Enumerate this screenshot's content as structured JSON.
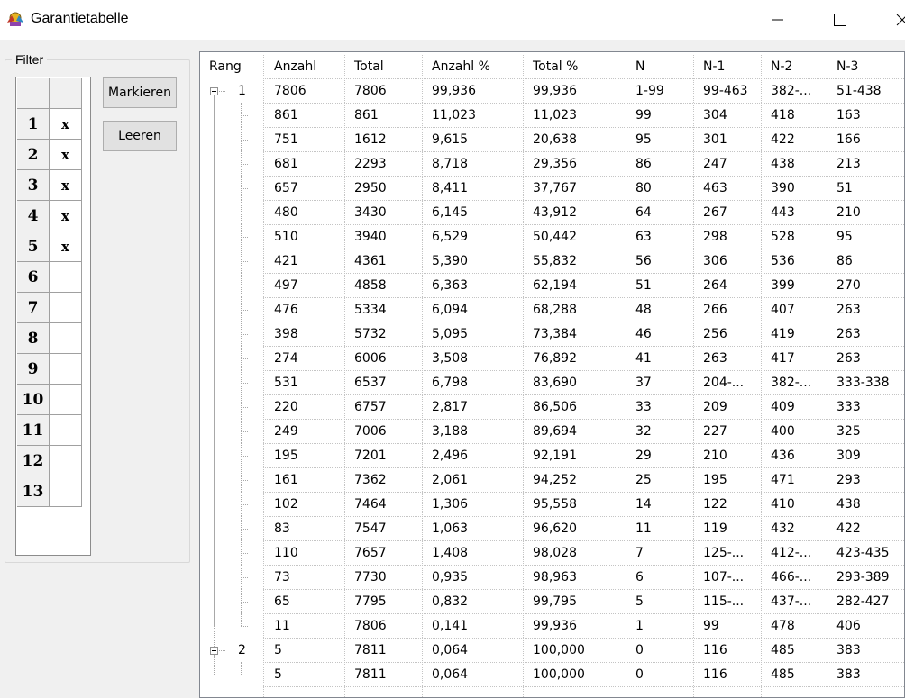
{
  "window": {
    "title": "Garantietabelle",
    "icon": "app-icon"
  },
  "filter": {
    "legend": "Filter",
    "rows": [
      {
        "num": "1",
        "val": "x"
      },
      {
        "num": "2",
        "val": "x"
      },
      {
        "num": "3",
        "val": "x"
      },
      {
        "num": "4",
        "val": "x"
      },
      {
        "num": "5",
        "val": "x"
      },
      {
        "num": "6",
        "val": ""
      },
      {
        "num": "7",
        "val": ""
      },
      {
        "num": "8",
        "val": ""
      },
      {
        "num": "9",
        "val": ""
      },
      {
        "num": "10",
        "val": ""
      },
      {
        "num": "11",
        "val": ""
      },
      {
        "num": "12",
        "val": ""
      },
      {
        "num": "13",
        "val": ""
      }
    ],
    "mark_label": "Markieren",
    "clear_label": "Leeren"
  },
  "table": {
    "columns": [
      "Rang",
      "Anzahl",
      "Total",
      "Anzahl %",
      "Total %",
      "N",
      "N-1",
      "N-2",
      "N-3"
    ],
    "rows": [
      {
        "level": 0,
        "rang": "1",
        "cells": [
          "7806",
          "7806",
          "99,936",
          "99,936",
          "1-99",
          "99-463",
          "382-...",
          "51-438"
        ]
      },
      {
        "level": 1,
        "rang": "",
        "cells": [
          "861",
          "861",
          "11,023",
          "11,023",
          "99",
          "304",
          "418",
          "163"
        ]
      },
      {
        "level": 1,
        "rang": "",
        "cells": [
          "751",
          "1612",
          "9,615",
          "20,638",
          "95",
          "301",
          "422",
          "166"
        ]
      },
      {
        "level": 1,
        "rang": "",
        "cells": [
          "681",
          "2293",
          "8,718",
          "29,356",
          "86",
          "247",
          "438",
          "213"
        ]
      },
      {
        "level": 1,
        "rang": "",
        "cells": [
          "657",
          "2950",
          "8,411",
          "37,767",
          "80",
          "463",
          "390",
          "51"
        ]
      },
      {
        "level": 1,
        "rang": "",
        "cells": [
          "480",
          "3430",
          "6,145",
          "43,912",
          "64",
          "267",
          "443",
          "210"
        ]
      },
      {
        "level": 1,
        "rang": "",
        "cells": [
          "510",
          "3940",
          "6,529",
          "50,442",
          "63",
          "298",
          "528",
          "95"
        ]
      },
      {
        "level": 1,
        "rang": "",
        "cells": [
          "421",
          "4361",
          "5,390",
          "55,832",
          "56",
          "306",
          "536",
          "86"
        ]
      },
      {
        "level": 1,
        "rang": "",
        "cells": [
          "497",
          "4858",
          "6,363",
          "62,194",
          "51",
          "264",
          "399",
          "270"
        ]
      },
      {
        "level": 1,
        "rang": "",
        "cells": [
          "476",
          "5334",
          "6,094",
          "68,288",
          "48",
          "266",
          "407",
          "263"
        ]
      },
      {
        "level": 1,
        "rang": "",
        "cells": [
          "398",
          "5732",
          "5,095",
          "73,384",
          "46",
          "256",
          "419",
          "263"
        ]
      },
      {
        "level": 1,
        "rang": "",
        "cells": [
          "274",
          "6006",
          "3,508",
          "76,892",
          "41",
          "263",
          "417",
          "263"
        ]
      },
      {
        "level": 1,
        "rang": "",
        "cells": [
          "531",
          "6537",
          "6,798",
          "83,690",
          "37",
          "204-...",
          "382-...",
          "333-338"
        ]
      },
      {
        "level": 1,
        "rang": "",
        "cells": [
          "220",
          "6757",
          "2,817",
          "86,506",
          "33",
          "209",
          "409",
          "333"
        ]
      },
      {
        "level": 1,
        "rang": "",
        "cells": [
          "249",
          "7006",
          "3,188",
          "89,694",
          "32",
          "227",
          "400",
          "325"
        ]
      },
      {
        "level": 1,
        "rang": "",
        "cells": [
          "195",
          "7201",
          "2,496",
          "92,191",
          "29",
          "210",
          "436",
          "309"
        ]
      },
      {
        "level": 1,
        "rang": "",
        "cells": [
          "161",
          "7362",
          "2,061",
          "94,252",
          "25",
          "195",
          "471",
          "293"
        ]
      },
      {
        "level": 1,
        "rang": "",
        "cells": [
          "102",
          "7464",
          "1,306",
          "95,558",
          "14",
          "122",
          "410",
          "438"
        ]
      },
      {
        "level": 1,
        "rang": "",
        "cells": [
          "83",
          "7547",
          "1,063",
          "96,620",
          "11",
          "119",
          "432",
          "422"
        ]
      },
      {
        "level": 1,
        "rang": "",
        "cells": [
          "110",
          "7657",
          "1,408",
          "98,028",
          "7",
          "125-...",
          "412-...",
          "423-435"
        ]
      },
      {
        "level": 1,
        "rang": "",
        "cells": [
          "73",
          "7730",
          "0,935",
          "98,963",
          "6",
          "107-...",
          "466-...",
          "293-389"
        ]
      },
      {
        "level": 1,
        "rang": "",
        "cells": [
          "65",
          "7795",
          "0,832",
          "99,795",
          "5",
          "115-...",
          "437-...",
          "282-427"
        ]
      },
      {
        "level": 1,
        "rang": "",
        "cells": [
          "11",
          "7806",
          "0,141",
          "99,936",
          "1",
          "99",
          "478",
          "406"
        ]
      },
      {
        "level": 0,
        "rang": "2",
        "cells": [
          "5",
          "7811",
          "0,064",
          "100,000",
          "0",
          "116",
          "485",
          "383"
        ]
      },
      {
        "level": 1,
        "rang": "",
        "cells": [
          "5",
          "7811",
          "0,064",
          "100,000",
          "0",
          "116",
          "485",
          "383"
        ]
      }
    ]
  }
}
